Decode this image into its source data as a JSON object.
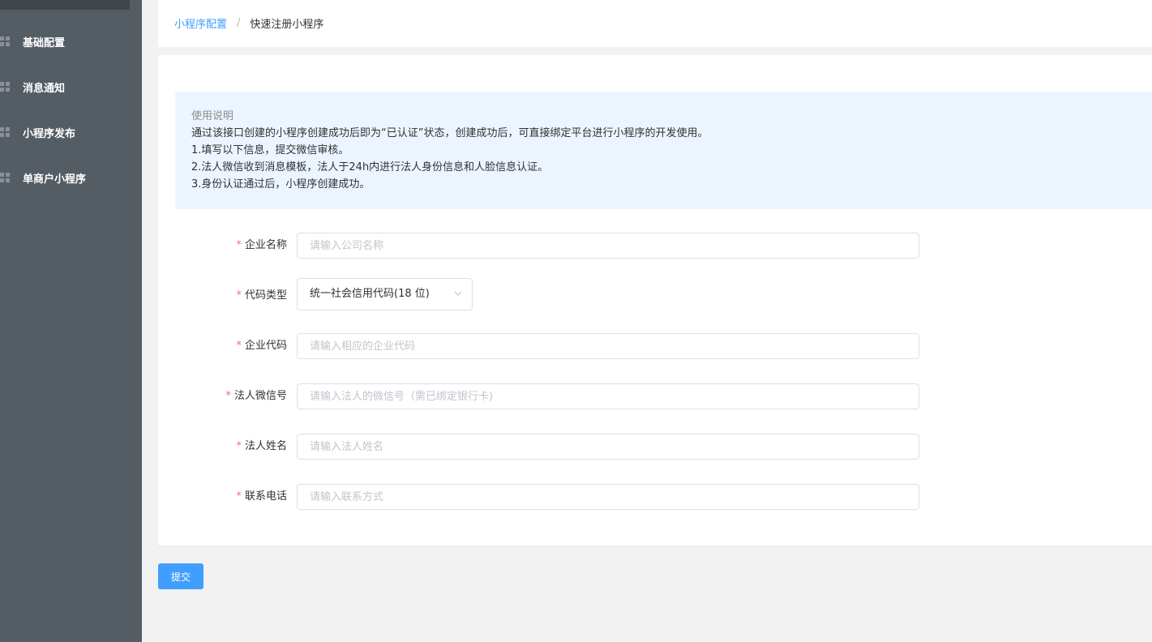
{
  "sidebar": {
    "items": [
      {
        "label": "基础配置",
        "icon": "grid-icon"
      },
      {
        "label": "消息通知",
        "icon": "grid-icon"
      },
      {
        "label": "小程序发布",
        "icon": "grid-icon"
      },
      {
        "label": "单商户小程序",
        "icon": "grid-icon"
      }
    ]
  },
  "breadcrumb": {
    "parent": "小程序配置",
    "separator": "/",
    "current": "快速注册小程序"
  },
  "notice": {
    "title": "使用说明",
    "lines": [
      "通过该接口创建的小程序创建成功后即为“已认证”状态，创建成功后，可直接绑定平台进行小程序的开发使用。",
      "1.填写以下信息，提交微信审核。",
      "2.法人微信收到消息模板，法人于24h内进行法人身份信息和人脸信息认证。",
      "3.身份认证通过后，小程序创建成功。"
    ]
  },
  "form": {
    "required_mark": "*",
    "company_name": {
      "label": "企业名称",
      "placeholder": "请输入公司名称",
      "value": ""
    },
    "code_type": {
      "label": "代码类型",
      "selected": "统一社会信用代码(18 位)"
    },
    "company_code": {
      "label": "企业代码",
      "placeholder": "请输入相应的企业代码",
      "value": ""
    },
    "legal_wechat": {
      "label": "法人微信号",
      "placeholder": "请输入法人的微信号（需已绑定银行卡)",
      "value": ""
    },
    "legal_name": {
      "label": "法人姓名",
      "placeholder": "请输入法人姓名",
      "value": ""
    },
    "contact_phone": {
      "label": "联系电话",
      "placeholder": "请输入联系方式",
      "value": ""
    }
  },
  "actions": {
    "submit_label": "提交"
  },
  "colors": {
    "accent": "#409eff",
    "sidebar_bg": "#545c64",
    "required": "#f56c6c",
    "notice_bg": "#ecf5ff"
  }
}
